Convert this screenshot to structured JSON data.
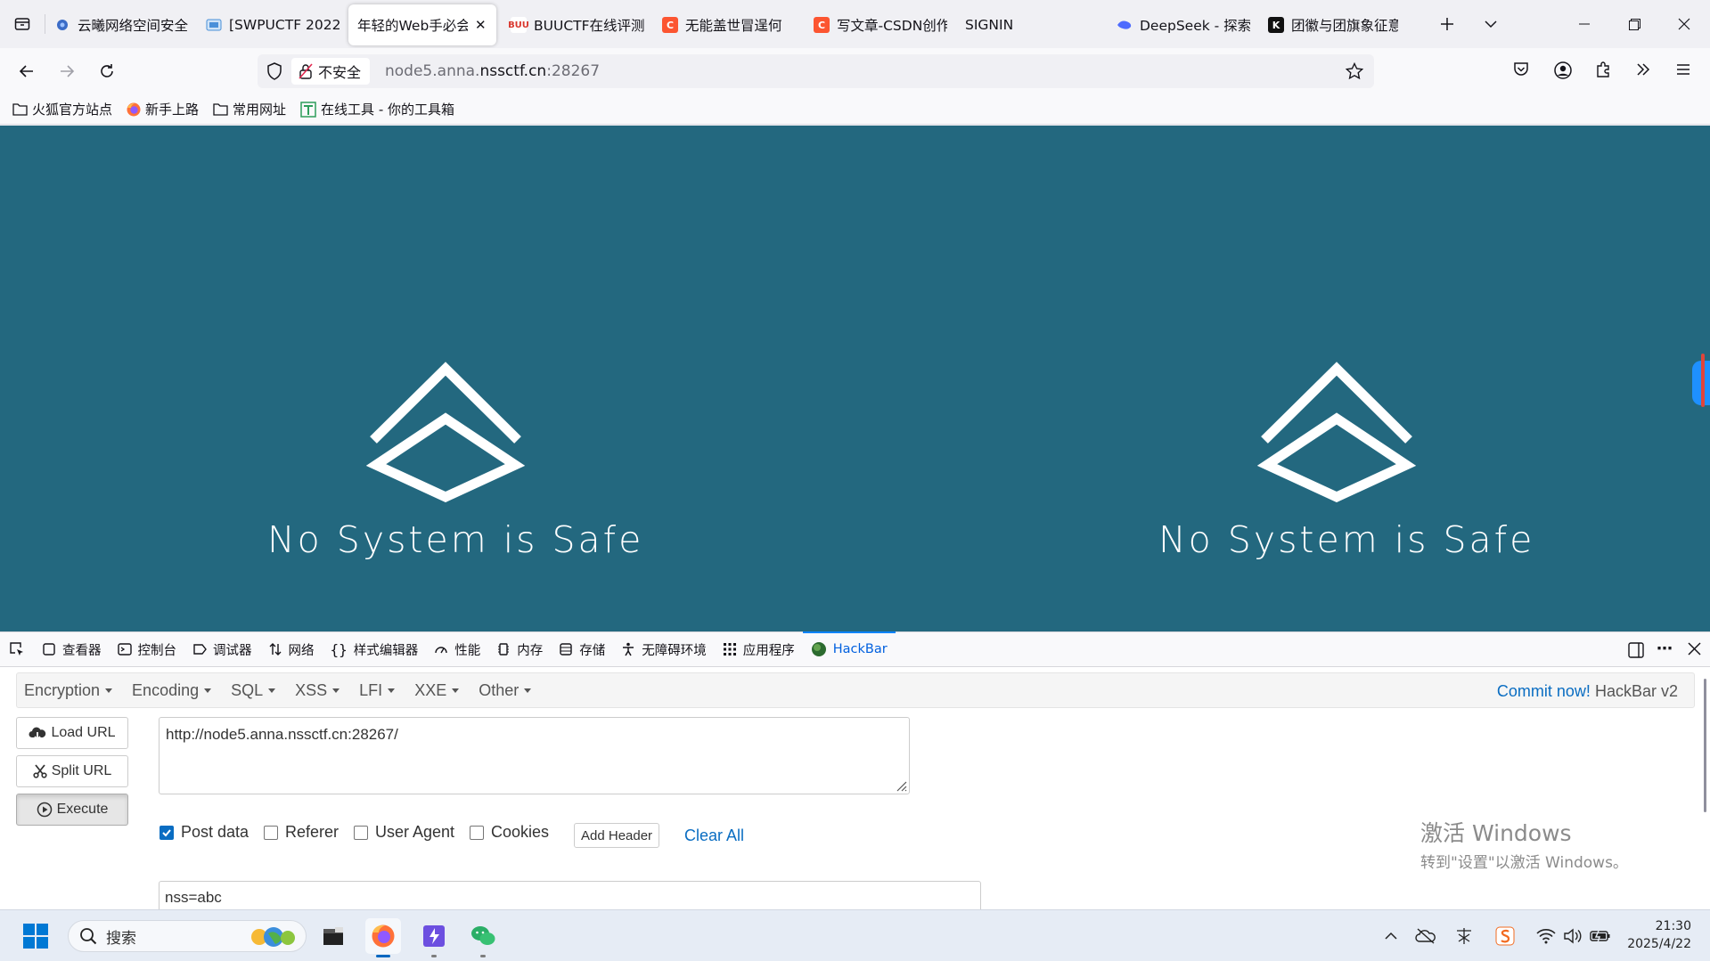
{
  "browser": {
    "tabs": [
      {
        "title": "云曦网络空间安全",
        "favicon": "cloud-logo-icon",
        "color": "#3b6cc7"
      },
      {
        "title": "[SWPUCTF 2022",
        "favicon": "nss-logo-icon",
        "color": "#4a90d9"
      },
      {
        "title": "年轻的Web手必会",
        "favicon": "",
        "color": "",
        "active": true
      },
      {
        "title": "BUUCTF在线评测",
        "favicon": "buu-logo-icon",
        "color": "#d9382f"
      },
      {
        "title": "无能盖世冒逞何",
        "favicon": "csdn-logo-icon",
        "color": "#fc5531"
      },
      {
        "title": "写文章-CSDN创作",
        "favicon": "csdn-logo-icon",
        "color": "#fc5531"
      },
      {
        "title": "SIGNIN",
        "favicon": "",
        "color": ""
      },
      {
        "title": "DeepSeek - 探索",
        "favicon": "deepseek-logo-icon",
        "color": "#4d6bfe"
      },
      {
        "title": "团徽与团旗象征意",
        "favicon": "kimi-logo-icon",
        "color": "#111111"
      }
    ],
    "urlbar": {
      "security_label": "不安全",
      "url_prefix": "node5.anna.",
      "url_domain": "nssctf.cn",
      "url_suffix": ":28267"
    },
    "bookmarks": [
      {
        "label": "火狐官方站点",
        "icon": "folder-icon"
      },
      {
        "label": "新手上路",
        "icon": "firefox-icon"
      },
      {
        "label": "常用网址",
        "icon": "folder-icon"
      },
      {
        "label": "在线工具 - 你的工具箱",
        "icon": "tools-logo-icon"
      }
    ]
  },
  "page": {
    "background": "#23687f",
    "slogan_left": "No System is Safe",
    "slogan_right": "No System is Safe"
  },
  "devtools": {
    "tabs": [
      {
        "label": "查看器",
        "icon": "inspector-icon"
      },
      {
        "label": "控制台",
        "icon": "console-icon"
      },
      {
        "label": "调试器",
        "icon": "debugger-icon"
      },
      {
        "label": "网络",
        "icon": "network-icon"
      },
      {
        "label": "样式编辑器",
        "icon": "style-editor-icon"
      },
      {
        "label": "性能",
        "icon": "performance-icon"
      },
      {
        "label": "内存",
        "icon": "memory-icon"
      },
      {
        "label": "存储",
        "icon": "storage-icon"
      },
      {
        "label": "无障碍环境",
        "icon": "accessibility-icon"
      },
      {
        "label": "应用程序",
        "icon": "application-icon"
      },
      {
        "label": "HackBar",
        "icon": "hackbar-icon",
        "active": true
      }
    ]
  },
  "hackbar": {
    "menu": [
      "Encryption",
      "Encoding",
      "SQL",
      "XSS",
      "LFI",
      "XXE",
      "Other"
    ],
    "commit_link": "Commit now!",
    "version": "HackBar v2",
    "buttons": {
      "load": "Load URL",
      "split": "Split URL",
      "execute": "Execute"
    },
    "url_value": "http://node5.anna.nssctf.cn:28267/",
    "options": [
      {
        "label": "Post data",
        "checked": true
      },
      {
        "label": "Referer",
        "checked": false
      },
      {
        "label": "User Agent",
        "checked": false
      },
      {
        "label": "Cookies",
        "checked": false
      }
    ],
    "add_header": "Add Header",
    "clear_all": "Clear All",
    "post_value": "nss=abc"
  },
  "watermark": {
    "line1": "激活 Windows",
    "line2": "转到\"设置\"以激活 Windows。"
  },
  "taskbar": {
    "search_placeholder": "搜索",
    "time": "21:30",
    "date": "2025/4/22",
    "apps": [
      "start-icon",
      "file-explorer-icon",
      "firefox-icon",
      "visual-studio-icon",
      "wechat-icon"
    ]
  }
}
